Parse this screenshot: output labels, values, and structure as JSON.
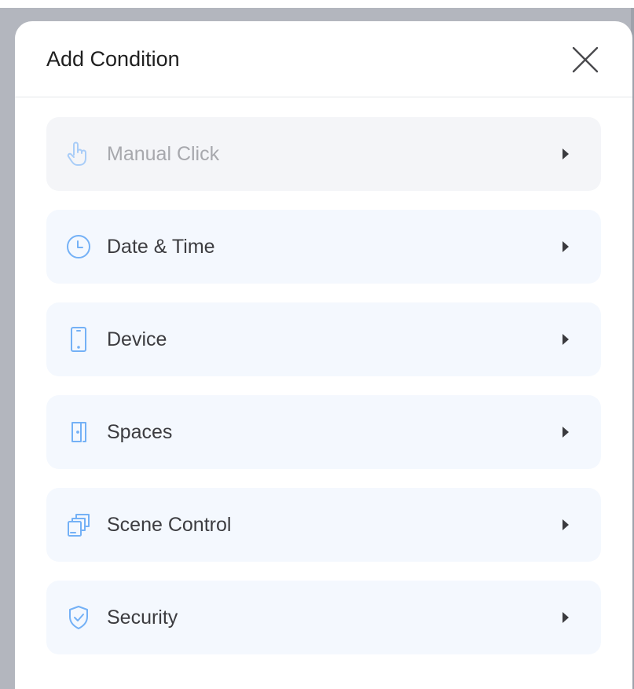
{
  "dialog": {
    "title": "Add Condition",
    "close_icon": "close-icon"
  },
  "options": [
    {
      "label": "Manual Click",
      "icon": "hand-pointer-icon",
      "enabled": false
    },
    {
      "label": "Date & Time",
      "icon": "clock-icon",
      "enabled": true
    },
    {
      "label": "Device",
      "icon": "phone-icon",
      "enabled": true
    },
    {
      "label": "Spaces",
      "icon": "door-icon",
      "enabled": true
    },
    {
      "label": "Scene Control",
      "icon": "scene-icon",
      "enabled": true
    },
    {
      "label": "Security",
      "icon": "shield-icon",
      "enabled": true
    }
  ],
  "colors": {
    "accent": "#74b1f6",
    "accent_disabled": "#a9cdf8",
    "item_background": "#f4f8fe",
    "item_background_disabled": "#f4f5f8",
    "chevron": "#3a3a3e"
  }
}
